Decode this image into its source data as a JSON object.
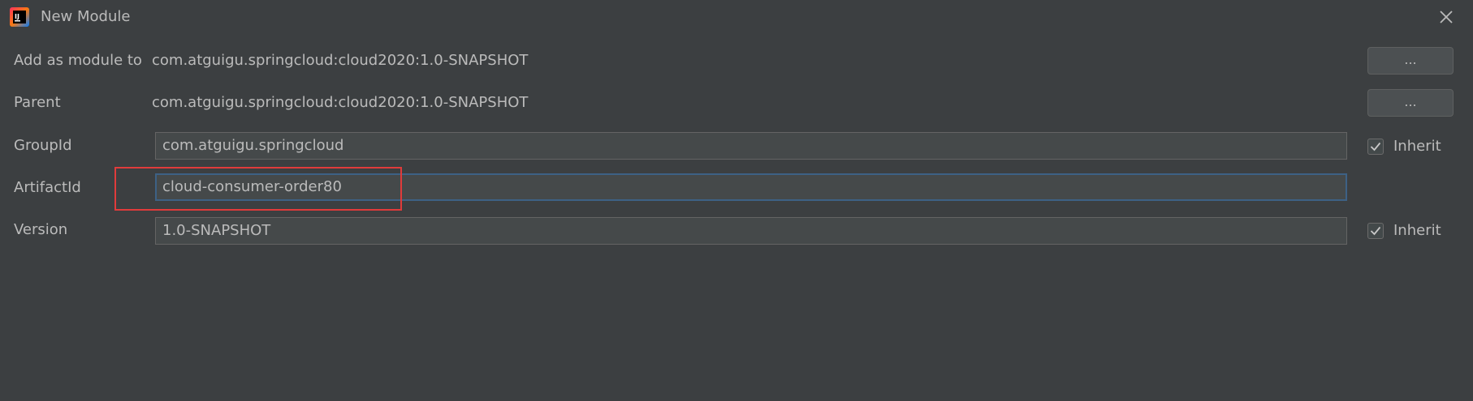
{
  "window": {
    "title": "New Module",
    "app_icon": "intellij-idea-icon",
    "close_icon": "close-icon"
  },
  "form": {
    "add_as_module_to": {
      "label": "Add as module to",
      "value": "com.atguigu.springcloud:cloud2020:1.0-SNAPSHOT",
      "button_label": "..."
    },
    "parent": {
      "label": "Parent",
      "value": "com.atguigu.springcloud:cloud2020:1.0-SNAPSHOT",
      "button_label": "..."
    },
    "group_id": {
      "label": "GroupId",
      "value": "com.atguigu.springcloud",
      "inherit_label": "Inherit",
      "inherit_checked": true
    },
    "artifact_id": {
      "label": "ArtifactId",
      "value": "cloud-consumer-order80"
    },
    "version": {
      "label": "Version",
      "value": "1.0-SNAPSHOT",
      "inherit_label": "Inherit",
      "inherit_checked": true
    }
  },
  "colors": {
    "background": "#3c3f41",
    "text": "#bbbbbb",
    "focus_border": "#3d6185",
    "annotation_highlight": "#e03b3b"
  }
}
